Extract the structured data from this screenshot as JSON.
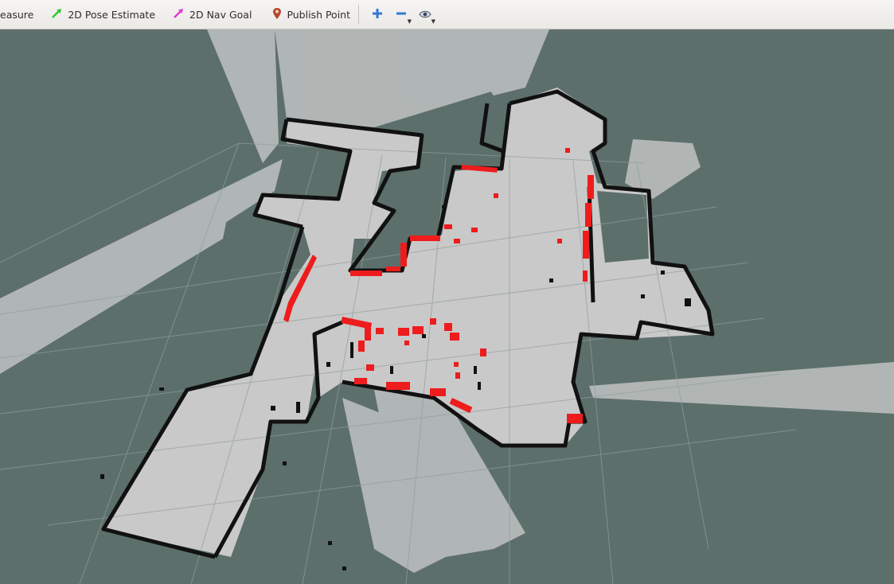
{
  "toolbar": {
    "tools": [
      {
        "id": "measure",
        "label": "easure",
        "icon": "measure-icon"
      },
      {
        "id": "pose-estimate",
        "label": "2D Pose Estimate",
        "icon": "green-arrow-icon"
      },
      {
        "id": "nav-goal",
        "label": "2D Nav Goal",
        "icon": "magenta-arrow-icon"
      },
      {
        "id": "publish-point",
        "label": "Publish Point",
        "icon": "map-pin-icon"
      }
    ],
    "buttons": [
      {
        "id": "add-tool",
        "icon": "plus-icon"
      },
      {
        "id": "remove-tool",
        "icon": "minus-icon"
      },
      {
        "id": "view",
        "icon": "eye-icon"
      }
    ]
  },
  "colors": {
    "background": "#5d6f6b",
    "free_space": "#c8c8c8",
    "obstacle": "#111111",
    "laser_scan": "#ee1c1c",
    "grid": "#8e9f9b",
    "pose_arrow": "#31c72e",
    "goal_arrow": "#e03ad4",
    "pin": "#b5482a",
    "plus": "#2f78d6"
  }
}
